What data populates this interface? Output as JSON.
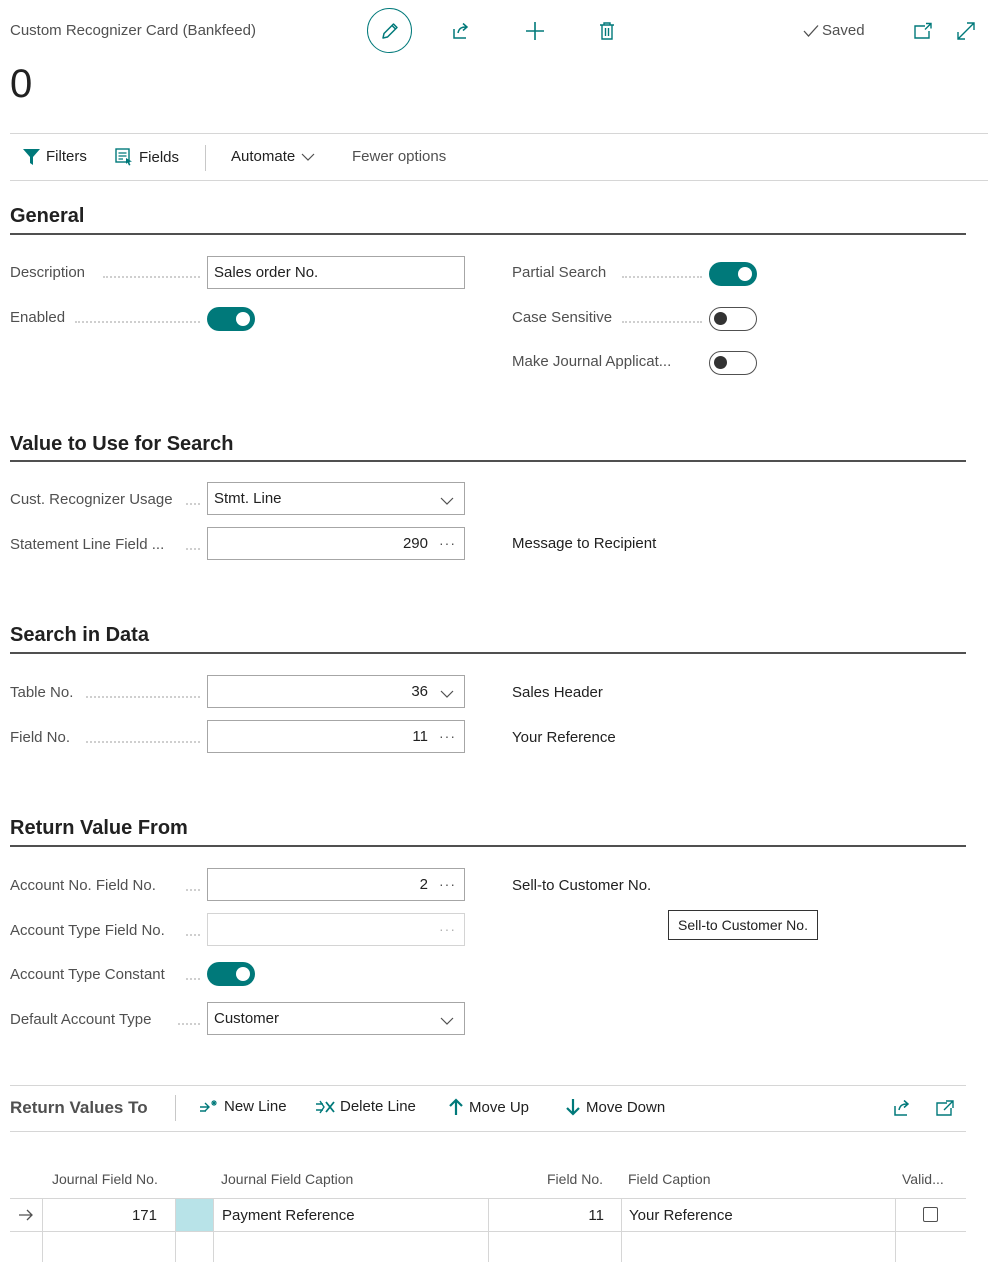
{
  "header": {
    "page_title": "Custom Recognizer Card (Bankfeed)",
    "record_name": "0",
    "saved_label": "Saved"
  },
  "actions": {
    "filters": "Filters",
    "fields": "Fields",
    "automate": "Automate",
    "fewer_options": "Fewer options"
  },
  "general": {
    "title": "General",
    "description_label": "Description",
    "description_value": "Sales order No.",
    "enabled_label": "Enabled",
    "enabled": true,
    "partial_search_label": "Partial Search",
    "partial_search": true,
    "case_sensitive_label": "Case Sensitive",
    "case_sensitive": false,
    "make_journal_label": "Make Journal Applicat...",
    "make_journal": false
  },
  "value_search": {
    "title": "Value to Use for Search",
    "usage_label": "Cust. Recognizer Usage",
    "usage_value": "Stmt. Line",
    "stmt_field_label": "Statement Line Field ...",
    "stmt_field_value": "290",
    "stmt_field_caption": "Message to Recipient"
  },
  "search_data": {
    "title": "Search in Data",
    "table_label": "Table No.",
    "table_value": "36",
    "table_caption": "Sales Header",
    "field_label": "Field No.",
    "field_value": "11",
    "field_caption": "Your Reference"
  },
  "return_from": {
    "title": "Return Value From",
    "acc_no_label": "Account No. Field No.",
    "acc_no_value": "2",
    "acc_no_caption": "Sell-to Customer No.",
    "tooltip": "Sell-to Customer No.",
    "acc_type_label": "Account Type Field No.",
    "acc_type_value": "",
    "acc_const_label": "Account Type Constant",
    "acc_const": true,
    "default_type_label": "Default Account Type",
    "default_type_value": "Customer"
  },
  "return_to": {
    "title": "Return Values To",
    "new_line": "New Line",
    "delete_line": "Delete Line",
    "move_up": "Move Up",
    "move_down": "Move Down",
    "columns": {
      "journal_field_no": "Journal Field No.",
      "journal_field_caption": "Journal Field Caption",
      "field_no": "Field No.",
      "field_caption": "Field Caption",
      "valid": "Valid..."
    },
    "rows": [
      {
        "journal_field_no": "171",
        "journal_field_caption": "Payment Reference",
        "field_no": "11",
        "field_caption": "Your Reference",
        "valid": false
      }
    ]
  },
  "colors": {
    "accent": "#00797a",
    "text": "#212121",
    "muted": "#505050"
  }
}
